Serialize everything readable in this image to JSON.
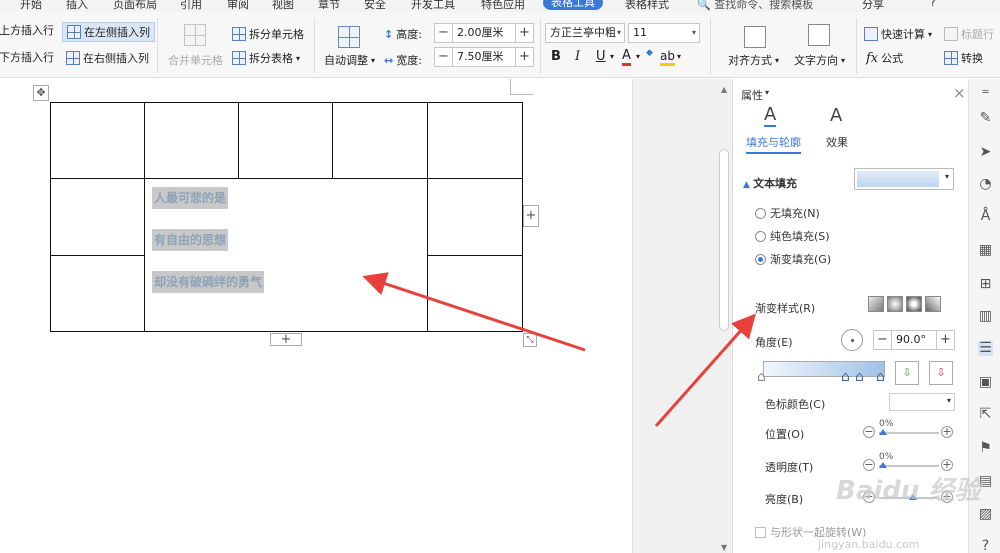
{
  "menubar": {
    "tabs": [
      "开始",
      "插入",
      "页面布局",
      "引用",
      "审阅",
      "视图",
      "章节",
      "安全",
      "开发工具",
      "特色应用",
      "表格工具",
      "表格样式"
    ],
    "active_tab": "表格工具",
    "search_placeholder": "查找命令、搜索模板",
    "share_label": "分享"
  },
  "ribbon": {
    "insert_above": "在上方插入行",
    "insert_below": "在下方插入行",
    "insert_left": "在左侧插入列",
    "insert_right": "在右侧插入列",
    "merge_cells": "合并单元格",
    "split_cells": "拆分单元格",
    "split_table": "拆分表格",
    "auto_fit": "自动调整",
    "height_label": "高度:",
    "height_value": "2.00厘米",
    "width_label": "宽度:",
    "width_value": "7.50厘米",
    "font_name": "方正兰亭中粗",
    "font_size": "11",
    "bold": "B",
    "italic": "I",
    "underline": "U",
    "font_color": "A",
    "highlight": "ab",
    "align": "对齐方式",
    "text_direction": "文字方向",
    "quick_calc": "快速计算",
    "formula": "公式",
    "title_row": "标题行",
    "convert": "转换",
    "minus": "−",
    "plus": "+"
  },
  "document": {
    "lines": [
      "人最可悲的是",
      "有自由的思想",
      "却没有破碉绊的勇气"
    ],
    "add_symbol": "+"
  },
  "panel": {
    "title": "属性",
    "close": "×",
    "tab_fill": "填充与轮廓",
    "tab_effect": "效果",
    "section_text_fill": "文本填充",
    "radio_none": "无填充(N)",
    "radio_solid": "纯色填充(S)",
    "radio_gradient": "渐变填充(G)",
    "gradient_style_label": "渐变样式(R)",
    "angle_label": "角度(E)",
    "angle_value": "90.0°",
    "stop_color_label": "色标颜色(C)",
    "position_label": "位置(O)",
    "position_value": "0%",
    "transparency_label": "透明度(T)",
    "transparency_value": "0%",
    "brightness_label": "亮度(B)",
    "rotate_with_shape": "与形状一起旋转(W)",
    "fill_color": "#bcd5f0"
  },
  "watermark": {
    "text": "Baidu 经验",
    "url": "jingyan.baidu.com"
  },
  "colors": {
    "accent": "#3a79d8",
    "arrow": "#e8403a",
    "selection": "#c8c8c8"
  }
}
